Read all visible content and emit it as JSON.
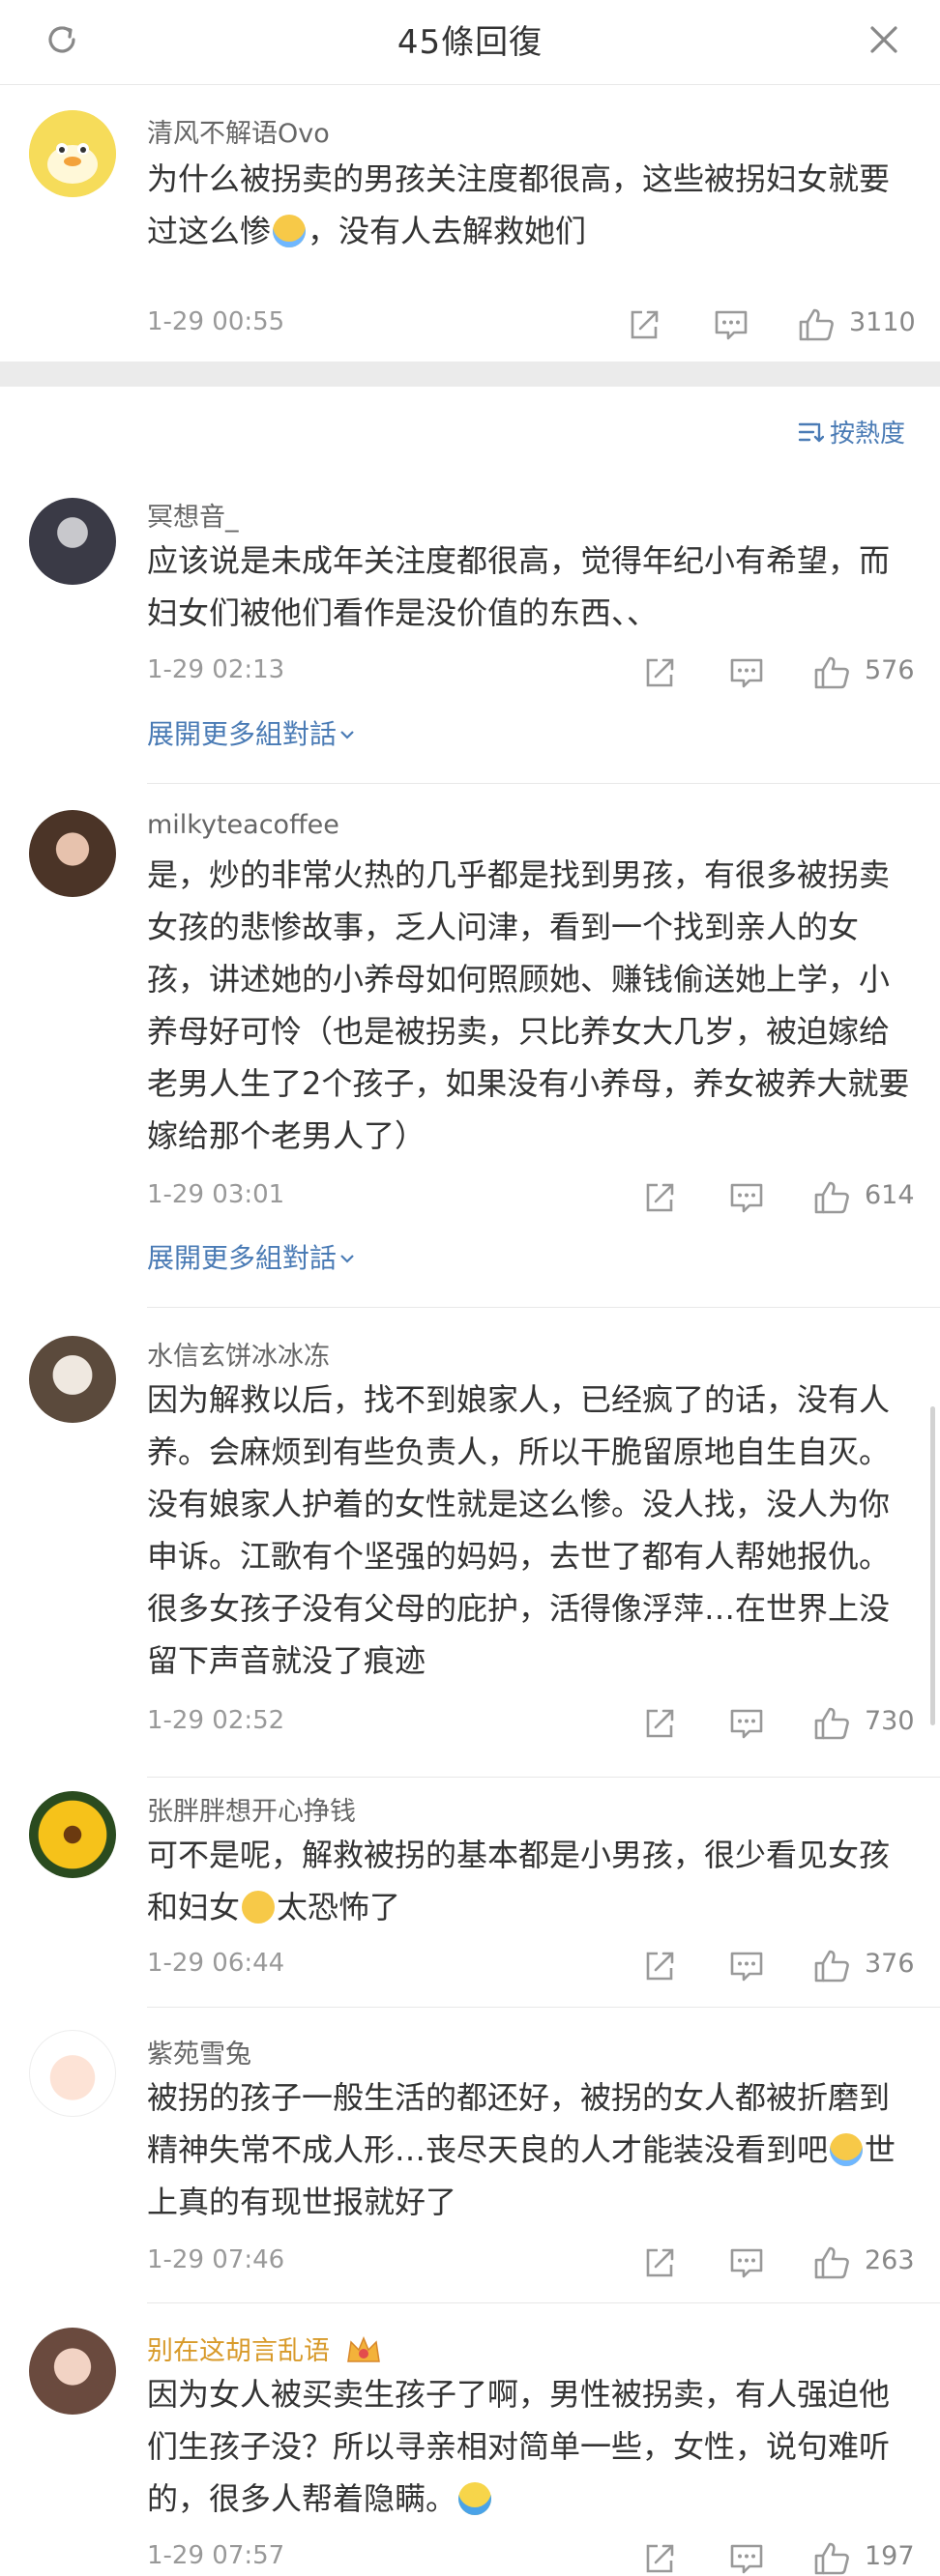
{
  "header": {
    "title": "45條回復"
  },
  "root_comment": {
    "username": "清风不解语Ovo",
    "text": "为什么被拐卖的男孩关注度都很高，这些被拐妇女就要过这么惨",
    "text_after": "，没有人去解救她们",
    "time": "1-29 00:55",
    "likes": "3110"
  },
  "sort_label": "按熱度",
  "expand_label": "展開更多組對話",
  "replies": [
    {
      "username": "冥想音_",
      "text": "应该说是未成年关注度都很高，觉得年纪小有希望，而妇女们被他们看作是没价值的东西、、",
      "time": "1-29 02:13",
      "likes": "576"
    },
    {
      "username": "milkyteacoffee",
      "text": "是，炒的非常火热的几乎都是找到男孩，有很多被拐卖女孩的悲惨故事，乏人问津，看到一个找到亲人的女孩，讲述她的小养母如何照顾她、赚钱偷送她上学，小养母好可怜（也是被拐卖，只比养女大几岁，被迫嫁给老男人生了2个孩子，如果没有小养母，养女被养大就要嫁给那个老男人了）",
      "time": "1-29 03:01",
      "likes": "614"
    },
    {
      "username": "水信玄饼冰冰冻",
      "text": "因为解救以后，找不到娘家人，已经疯了的话，没有人养。会麻烦到有些负责人，所以干脆留原地自生自灭。没有娘家人护着的女性就是这么惨。没人找，没人为你申诉。江歌有个坚强的妈妈，去世了都有人帮她报仇。很多女孩子没有父母的庇护，活得像浮萍…在世界上没留下声音就没了痕迹",
      "time": "1-29 02:52",
      "likes": "730"
    },
    {
      "username": "张胖胖想开心挣钱",
      "text": "可不是呢，解救被拐的基本都是小男孩，很少看见女孩和妇女",
      "text_after": "太恐怖了",
      "time": "1-29 06:44",
      "likes": "376"
    },
    {
      "username": "紫苑雪兔",
      "text": "被拐的孩子一般生活的都还好，被拐的女人都被折磨到精神失常不成人形…丧尽天良的人才能装没看到吧",
      "text_after": "世上真的有现世报就好了",
      "time": "1-29 07:46",
      "likes": "263"
    },
    {
      "username": "别在这胡言乱语",
      "text": "因为女人被买卖生孩子了啊，男性被拐卖，有人强迫他们生孩子没？所以寻亲相对简单一些，女性，说句难听的，很多人帮着隐瞒。",
      "time": "1-29 07:57",
      "likes": "197"
    }
  ],
  "icons": {
    "share": "share-icon",
    "comment": "comment-icon",
    "like": "thumbs-up-icon",
    "refresh": "refresh-icon",
    "close": "close-icon",
    "sort": "sort-icon",
    "chevron": "chevron-down-icon"
  },
  "colors": {
    "link": "#4a7bb5",
    "gold": "#d89a2a",
    "meta": "#999999"
  }
}
